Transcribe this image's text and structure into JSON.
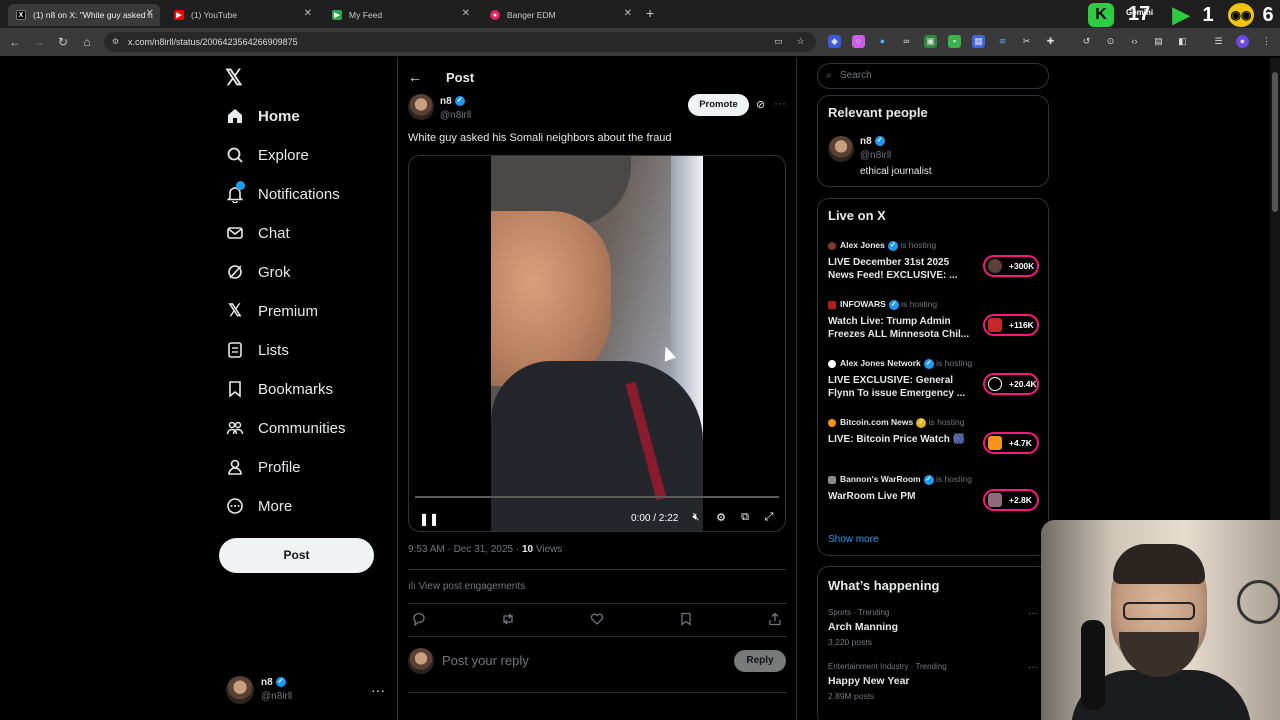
{
  "browser": {
    "tabs": [
      {
        "title": "(1) n8 on X: \"White guy asked h",
        "active": true
      },
      {
        "title": "(1) YouTube",
        "active": false
      },
      {
        "title": "My Feed",
        "active": false
      },
      {
        "title": "Banger EDM",
        "active": false
      }
    ],
    "url": "x.com/n8irll/status/2006423564266909875",
    "ext_counter_1": "17",
    "ext_counter_2": "1",
    "ext_counter_3": "6",
    "ext_label": "Gemini"
  },
  "nav": {
    "items": [
      {
        "label": "Home",
        "icon": "home-icon"
      },
      {
        "label": "Explore",
        "icon": "search-icon"
      },
      {
        "label": "Notifications",
        "icon": "bell-icon"
      },
      {
        "label": "Chat",
        "icon": "mail-icon"
      },
      {
        "label": "Grok",
        "icon": "grok-icon"
      },
      {
        "label": "Premium",
        "icon": "x-icon"
      },
      {
        "label": "Lists",
        "icon": "list-icon"
      },
      {
        "label": "Bookmarks",
        "icon": "bookmark-icon"
      },
      {
        "label": "Communities",
        "icon": "people-icon"
      },
      {
        "label": "Profile",
        "icon": "person-icon"
      },
      {
        "label": "More",
        "icon": "more-circle-icon"
      }
    ],
    "post_button": "Post",
    "account": {
      "name": "n8",
      "handle": "@n8irll"
    }
  },
  "post": {
    "header_title": "Post",
    "author_name": "n8",
    "author_handle": "@n8irll",
    "promote_label": "Promote",
    "text": "White guy asked his Somali neighbors about the fraud",
    "video": {
      "time": "0:00 / 2:22",
      "progress": 0
    },
    "timestamp": "9:53 AM · Dec 31, 2025 · ",
    "views_count": "10",
    "views_label": " Views",
    "engagements_label": "View post engagements",
    "reply_placeholder": "Post your reply",
    "reply_button": "Reply"
  },
  "sidebar": {
    "search_placeholder": "Search",
    "relevant_title": "Relevant people",
    "relevant_person": {
      "name": "n8",
      "handle": "@n8irll",
      "bio": "ethical journalist"
    },
    "live_title": "Live on X",
    "live": [
      {
        "host": "Alex Jones",
        "hosting": "is hosting",
        "title": "LIVE December 31st 2025 News Feed! EXCLUSIVE: ...",
        "count": "+300K"
      },
      {
        "host": "INFOWARS",
        "hosting": "is hosting",
        "title": "Watch Live: Trump Admin Freezes ALL Minnesota Chil...",
        "count": "+116K"
      },
      {
        "host": "Alex Jones Network",
        "hosting": "is hosting",
        "title": "LIVE EXCLUSIVE: General Flynn To issue Emergency ...",
        "count": "+20.4K"
      },
      {
        "host": "Bitcoin.com News",
        "hosting": "is hosting",
        "title": "LIVE: Bitcoin Price Watch 🎆",
        "count": "+4.7K"
      },
      {
        "host": "Bannon's WarRoom",
        "hosting": "is hosting",
        "title": "WarRoom Live PM",
        "count": "+2.8K"
      }
    ],
    "show_more": "Show more",
    "happening_title": "What’s happening",
    "trends": [
      {
        "category": "Sports · Trending",
        "name": "Arch Manning",
        "count": "3,220 posts"
      },
      {
        "category": "Entertainment Industry · Trending",
        "name": "Happy New Year",
        "count": "2.89M posts"
      }
    ]
  },
  "colors": {
    "accent": "#1d9bf0",
    "live_pill": "#f91880",
    "background": "#000000"
  }
}
